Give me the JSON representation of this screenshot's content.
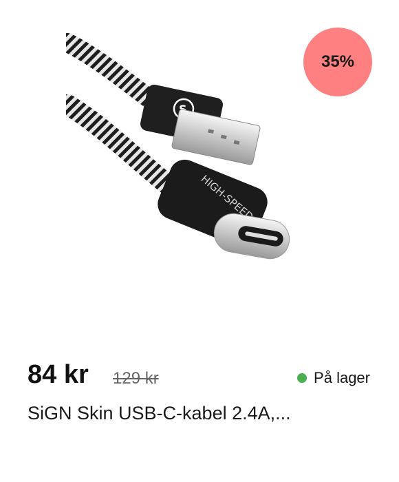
{
  "product": {
    "image_icon": "usb-c-cable-image",
    "image_text": "HIGH-SPEED",
    "discount_badge": "35%",
    "price_current": "84 kr",
    "price_old": "129 kr",
    "stock_status": "På lager",
    "title": "SiGN Skin USB-C-kabel 2.4A,..."
  },
  "colors": {
    "badge": "#ff8080",
    "in_stock_dot": "#4caf50",
    "text": "#1a1a1a"
  }
}
